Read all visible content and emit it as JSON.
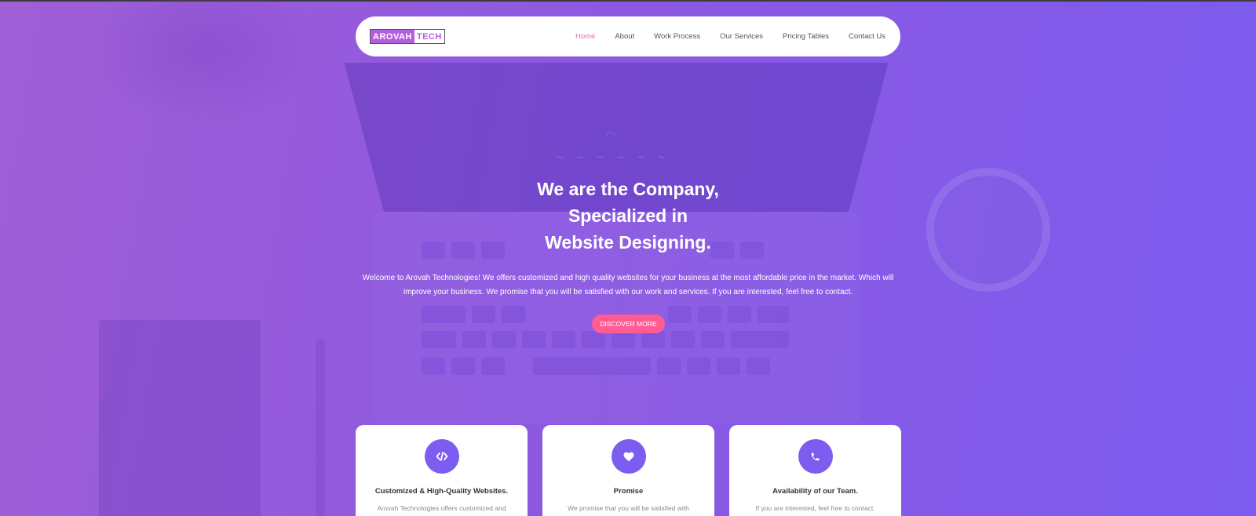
{
  "brand": {
    "logo_part1": "AROVAH",
    "logo_part2": "TECH"
  },
  "nav": {
    "items": [
      {
        "label": "Home",
        "active": true
      },
      {
        "label": "About"
      },
      {
        "label": "Work Process"
      },
      {
        "label": "Our Services"
      },
      {
        "label": "Pricing Tables"
      },
      {
        "label": "Contact Us"
      }
    ]
  },
  "hero": {
    "line1_normal": "We are the ",
    "line1_bold": "Company,",
    "line2": "Specialized in",
    "line3_bold": "Website Designing.",
    "description": "Welcome to Arovah Technologies! We offers customized and high quality websites for your business at the most affordable price in the market. Which will improve your business. We promise that you will be satisfied with our work and services. If you are interested, feel free to contact.",
    "cta_label": "DISCOVER MORE"
  },
  "cards": [
    {
      "icon": "code-icon",
      "title": "Customized & High-Quality Websites.",
      "text": "Arovah Technologies offers customized and"
    },
    {
      "icon": "heart-icon",
      "title": "Promise",
      "text": "We promise that you will be satisfied with"
    },
    {
      "icon": "phone-icon",
      "title": "Availability of our Team.",
      "text": "If you are interested, feel free to contact."
    }
  ],
  "colors": {
    "accent": "#7d5df0",
    "cta": "#ff5b95",
    "active_nav": "#e96fb3",
    "logo": "#b35ee0"
  }
}
